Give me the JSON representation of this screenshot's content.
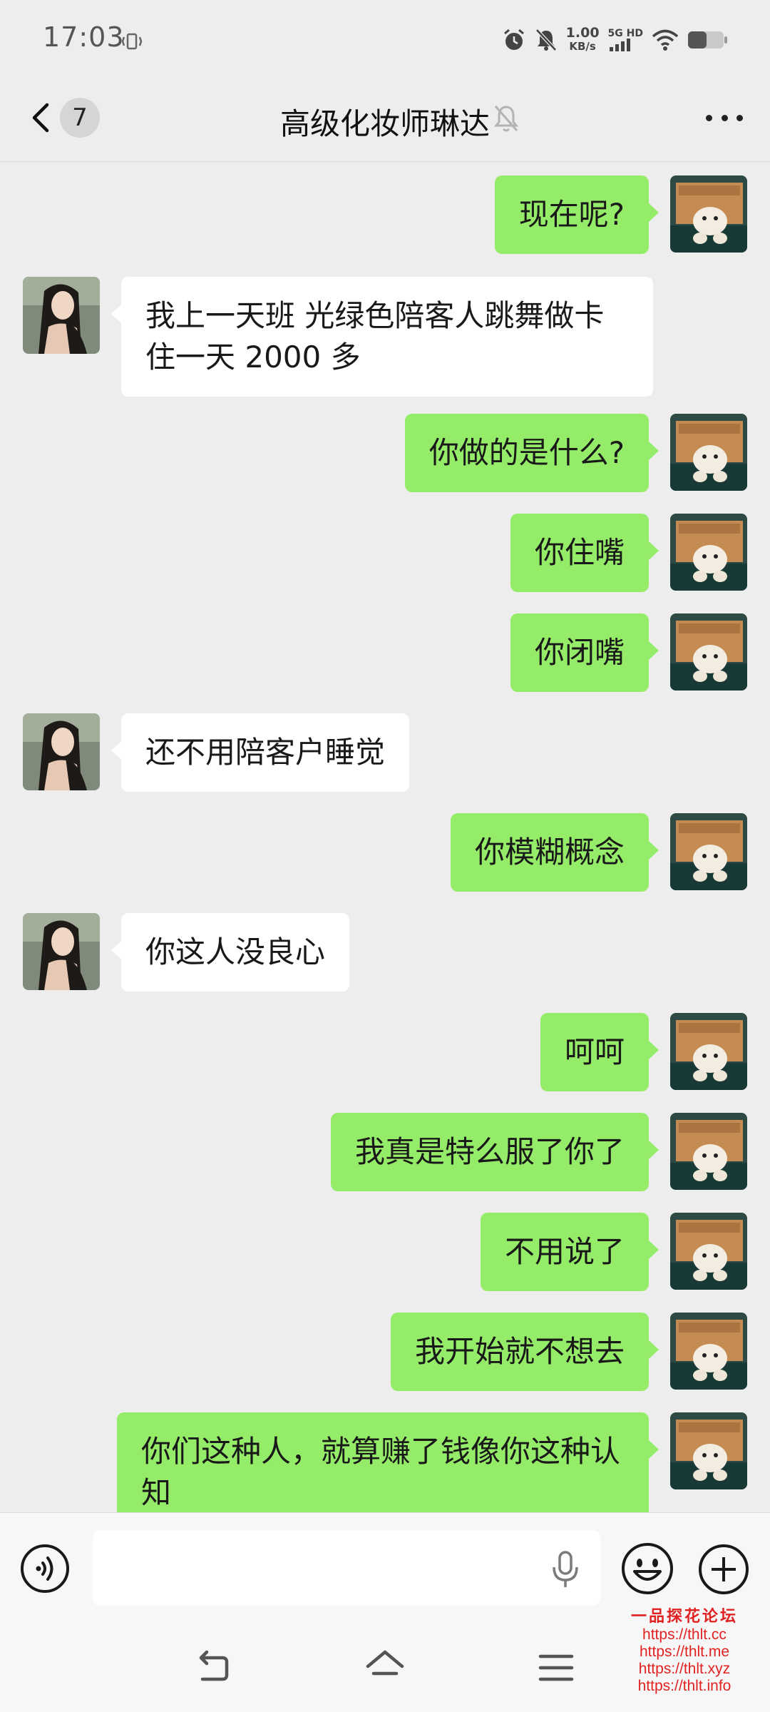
{
  "status_bar": {
    "time": "17:03",
    "speed_value": "1.00",
    "speed_unit": "KB/s",
    "network_top": "5G HD",
    "network_bottom": "ıll"
  },
  "header": {
    "unread_count": "7",
    "title": "高级化妆师琳达"
  },
  "messages": [
    {
      "from": "me",
      "text": "现在呢?"
    },
    {
      "from": "other",
      "text": "我上一天班 光绿色陪客人跳舞做卡住一天 2000 多"
    },
    {
      "from": "me",
      "text": "你做的是什么?"
    },
    {
      "from": "me",
      "text": "你住嘴"
    },
    {
      "from": "me",
      "text": "你闭嘴"
    },
    {
      "from": "other",
      "text": "还不用陪客户睡觉"
    },
    {
      "from": "me",
      "text": "你模糊概念"
    },
    {
      "from": "other",
      "text": "你这人没良心"
    },
    {
      "from": "me",
      "text": "呵呵"
    },
    {
      "from": "me",
      "text": "我真是特么服了你了"
    },
    {
      "from": "me",
      "text": "不用说了"
    },
    {
      "from": "me",
      "text": "我开始就不想去"
    },
    {
      "from": "me",
      "text": "你们这种人，就算赚了钱像你这种认知"
    }
  ],
  "input_bar": {
    "value": "",
    "placeholder": ""
  },
  "watermark": {
    "title": "一品探花论坛",
    "links": [
      "https://thlt.cc",
      "https://thlt.me",
      "https://thlt.xyz",
      "https://thlt.info"
    ]
  },
  "colors": {
    "background": "#ededed",
    "my_bubble": "#95ec69",
    "other_bubble": "#ffffff",
    "watermark": "#e02222"
  },
  "icons": [
    "vibrate-icon",
    "alarm-icon",
    "bell-off-icon",
    "wifi-icon",
    "battery-icon",
    "back-arrow-icon",
    "mute-icon",
    "more-icon",
    "voice-icon",
    "mic-icon",
    "emoji-icon",
    "plus-icon",
    "nav-back-icon",
    "nav-home-icon",
    "nav-menu-icon"
  ]
}
